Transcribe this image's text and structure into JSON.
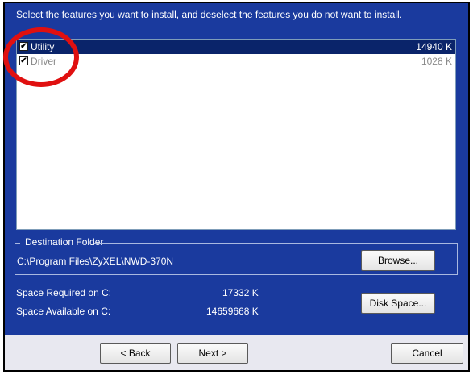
{
  "instruction": "Select the features you want to install, and deselect the features you do not want to install.",
  "features": [
    {
      "label": "Utility",
      "size": "14940 K",
      "checked": true,
      "selected": true
    },
    {
      "label": "Driver",
      "size": "1028 K",
      "checked": true,
      "selected": false
    }
  ],
  "destination": {
    "legend": "Destination Folder",
    "path": "C:\\Program Files\\ZyXEL\\NWD-370N",
    "browse_label": "Browse..."
  },
  "space": {
    "required_label": "Space Required on C:",
    "required_value": "17332 K",
    "available_label": "Space Available on C:",
    "available_value": "14659668 K",
    "disk_space_label": "Disk Space..."
  },
  "buttons": {
    "back_label": "< Back",
    "next_label": "Next >",
    "cancel_label": "Cancel"
  },
  "colors": {
    "window_bg": "#1a3a9e",
    "selection": "#0a246a",
    "highlight_circle": "#e01010"
  }
}
